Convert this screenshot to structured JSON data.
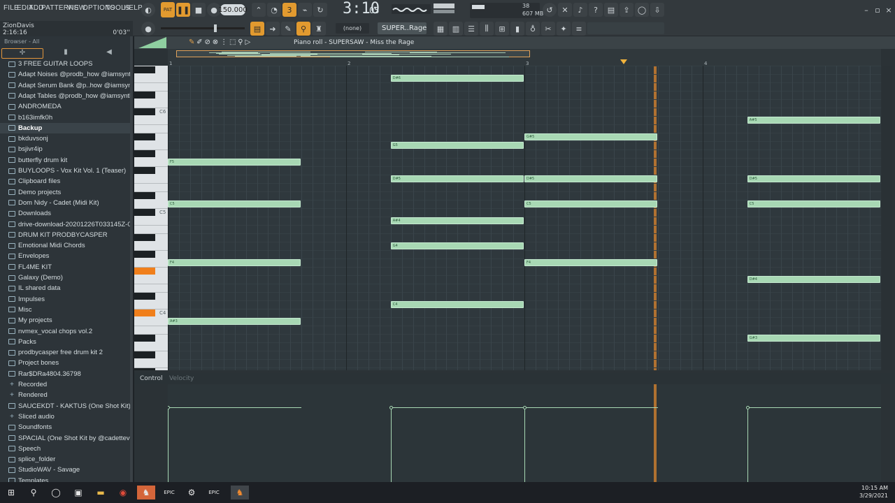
{
  "menu": [
    "FILE",
    "EDIT",
    "ADD",
    "PATTERNS",
    "VIEW",
    "OPTIONS",
    "TOOLS",
    "HELP"
  ],
  "transport": {
    "pat": "PAT",
    "tempo": "150.000",
    "time": "3:10",
    "time_small": "05",
    "cpu": "38",
    "memory": "607 MB",
    "voices": "5"
  },
  "hint": {
    "user": "ZionDavis",
    "value": "2:16:16",
    "pos": "0'03''"
  },
  "toolbar2": {
    "snap": "(none)",
    "channel": "SUPER..Rage"
  },
  "browser": {
    "header": "Browser - All",
    "items": [
      {
        "label": "3 FREE GUITAR LOOPS",
        "t": "f"
      },
      {
        "label": "Adapt Noises @prodb_how @iamsynthetic_",
        "t": "f"
      },
      {
        "label": "Adapt Serum Bank @p..how @iamsynthetic_",
        "t": "f"
      },
      {
        "label": "Adapt Tables @prodb_how @iamsynthetic_",
        "t": "f"
      },
      {
        "label": "ANDROMEDA",
        "t": "f"
      },
      {
        "label": "b163imfk0h",
        "t": "f"
      },
      {
        "label": "Backup",
        "t": "sel"
      },
      {
        "label": "bkduvsonj",
        "t": "f"
      },
      {
        "label": "bsjivr4ip",
        "t": "f"
      },
      {
        "label": "butterfly drum kit",
        "t": "f"
      },
      {
        "label": "BUYLOOPS - Vox Kit Vol. 1 (Teaser)",
        "t": "f"
      },
      {
        "label": "Clipboard files",
        "t": "f"
      },
      {
        "label": "Demo projects",
        "t": "f"
      },
      {
        "label": "Dom Nidy - Cadet (Midi Kit)",
        "t": "f"
      },
      {
        "label": "Downloads",
        "t": "f"
      },
      {
        "label": "drive-download-20201226T033145Z-001",
        "t": "f"
      },
      {
        "label": "DRUM KIT PRODBYCASPER",
        "t": "f"
      },
      {
        "label": "Emotional Midi Chords",
        "t": "f"
      },
      {
        "label": "Envelopes",
        "t": "f"
      },
      {
        "label": "FL4ME KIT",
        "t": "f"
      },
      {
        "label": "Galaxy (Demo)",
        "t": "f"
      },
      {
        "label": "IL shared data",
        "t": "f"
      },
      {
        "label": "Impulses",
        "t": "f"
      },
      {
        "label": "Misc",
        "t": "f"
      },
      {
        "label": "My projects",
        "t": "f"
      },
      {
        "label": "nvmex_vocal chops vol.2",
        "t": "f"
      },
      {
        "label": "Packs",
        "t": "f"
      },
      {
        "label": "prodbycasper free drum kit 2",
        "t": "f"
      },
      {
        "label": "Project bones",
        "t": "f"
      },
      {
        "label": "Rar$DRa4804.36798",
        "t": "f"
      },
      {
        "label": "Recorded",
        "t": "p"
      },
      {
        "label": "Rendered",
        "t": "p"
      },
      {
        "label": "SAUCEKDT - KAKTUS (One Shot Kit)",
        "t": "f"
      },
      {
        "label": "Sliced audio",
        "t": "p"
      },
      {
        "label": "Soundfonts",
        "t": "f"
      },
      {
        "label": "SPACIAL (One Shot Kit by @cadettevini)",
        "t": "f"
      },
      {
        "label": "Speech",
        "t": "f"
      },
      {
        "label": "splice_folder",
        "t": "f"
      },
      {
        "label": "StudioWAV - Savage",
        "t": "f"
      },
      {
        "label": "Templates",
        "t": "f"
      }
    ]
  },
  "pianoroll": {
    "title": "Piano roll - SUPERSAW - Miss the Rage",
    "bars": [
      "1",
      "2",
      "3",
      "4"
    ],
    "key_labels": [
      "C6",
      "C5",
      "C4"
    ],
    "notes": [
      {
        "n": "F5",
        "b": 0,
        "l": 0.75,
        "k": 30
      },
      {
        "n": "C5",
        "b": 0,
        "l": 0.75,
        "k": 25
      },
      {
        "n": "F4",
        "b": 0,
        "l": 0.75,
        "k": 18
      },
      {
        "n": "A#3",
        "b": 0,
        "l": 0.75,
        "k": 11
      },
      {
        "n": "D#6",
        "b": 1.25,
        "l": 0.75,
        "k": 40
      },
      {
        "n": "G5",
        "b": 1.25,
        "l": 0.75,
        "k": 32
      },
      {
        "n": "D#5",
        "b": 1.25,
        "l": 0.75,
        "k": 28
      },
      {
        "n": "A#4",
        "b": 1.25,
        "l": 0.75,
        "k": 23
      },
      {
        "n": "G4",
        "b": 1.25,
        "l": 0.75,
        "k": 20
      },
      {
        "n": "C4",
        "b": 1.25,
        "l": 0.75,
        "k": 13
      },
      {
        "n": "G#5",
        "b": 2,
        "l": 0.75,
        "k": 33
      },
      {
        "n": "D#5",
        "b": 2,
        "l": 0.75,
        "k": 28
      },
      {
        "n": "C5",
        "b": 2,
        "l": 0.75,
        "k": 25
      },
      {
        "n": "F4",
        "b": 2,
        "l": 0.75,
        "k": 18
      },
      {
        "n": "A#5",
        "b": 3.25,
        "l": 0.75,
        "k": 35
      },
      {
        "n": "D#5",
        "b": 3.25,
        "l": 0.75,
        "k": 28
      },
      {
        "n": "C5",
        "b": 3.25,
        "l": 0.75,
        "k": 25
      },
      {
        "n": "D#4",
        "b": 3.25,
        "l": 0.75,
        "k": 16
      },
      {
        "n": "G#3",
        "b": 3.25,
        "l": 0.75,
        "k": 9
      }
    ],
    "control_label": "Control",
    "control_target": "Velocity"
  },
  "taskbar": {
    "time": "10:15 AM",
    "date": "3/29/2021"
  }
}
